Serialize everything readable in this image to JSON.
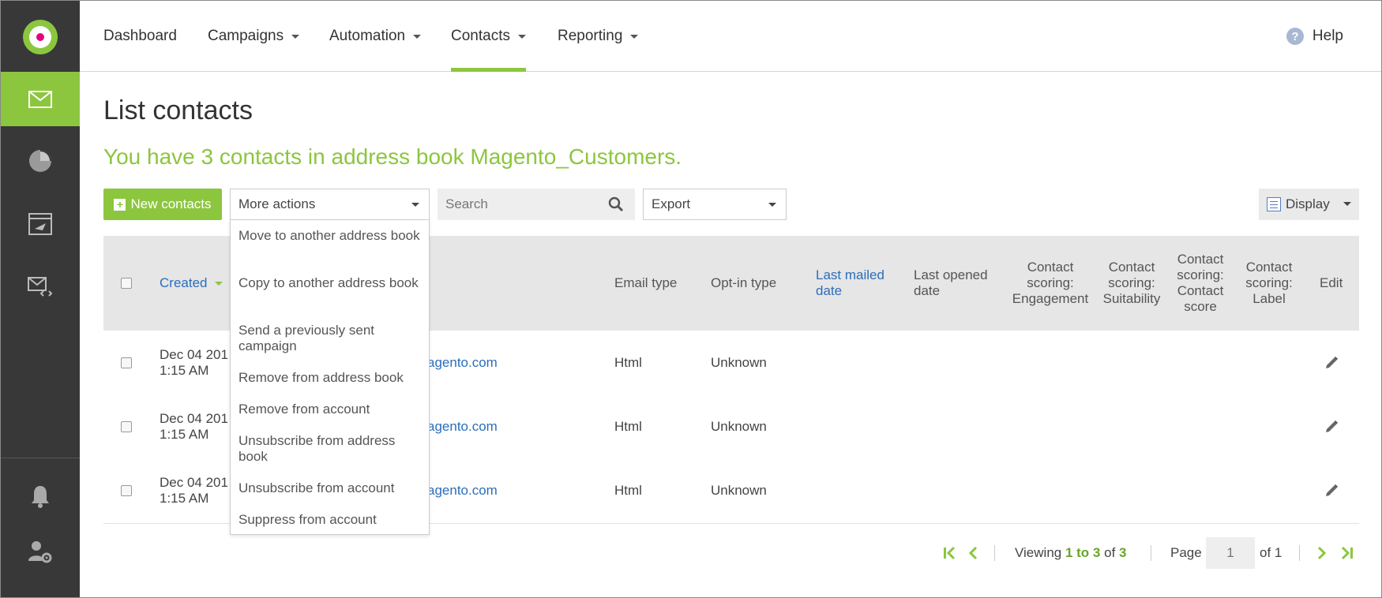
{
  "nav": {
    "dashboard": "Dashboard",
    "campaigns": "Campaigns",
    "automation": "Automation",
    "contacts": "Contacts",
    "reporting": "Reporting",
    "help": "Help"
  },
  "page": {
    "title": "List contacts",
    "summary": "You have 3 contacts in address book Magento_Customers."
  },
  "toolbar": {
    "new_contacts": "New contacts",
    "more_actions": "More actions",
    "search_placeholder": "Search",
    "export": "Export",
    "display": "Display"
  },
  "menu": {
    "items": [
      "Move to another address book",
      "Copy to another address book",
      "Send a previously sent campaign",
      "Remove from address book",
      "Remove from account",
      "Unsubscribe from address book",
      "Unsubscribe from account",
      "Suppress from account"
    ]
  },
  "table": {
    "headers": {
      "created": "Created",
      "email_type": "Email type",
      "optin_type": "Opt-in type",
      "last_mailed": "Last mailed date",
      "last_opened": "Last opened date",
      "engagement": "Contact scoring: Engagement",
      "suitability": "Contact scoring: Suitability",
      "contact_score": "Contact scoring: Contact score",
      "label": "Contact scoring: Label",
      "edit": "Edit"
    },
    "rows": [
      {
        "created_date": "Dec 04 201",
        "created_time": "1:15 AM",
        "email": "agento.com",
        "email_type": "Html",
        "optin": "Unknown"
      },
      {
        "created_date": "Dec 04 201",
        "created_time": "1:15 AM",
        "email": "agento.com",
        "email_type": "Html",
        "optin": "Unknown"
      },
      {
        "created_date": "Dec 04 201",
        "created_time": "1:15 AM",
        "email": "agento.com",
        "email_type": "Html",
        "optin": "Unknown"
      }
    ]
  },
  "pagination": {
    "viewing_label": "Viewing",
    "range": "1 to 3",
    "of_label": "of",
    "total": "3",
    "page_label": "Page",
    "page_value": "1",
    "of_pages": "of 1"
  },
  "colors": {
    "accent": "#8cc63f",
    "sidebar": "#383838",
    "link": "#2a6ebb"
  }
}
